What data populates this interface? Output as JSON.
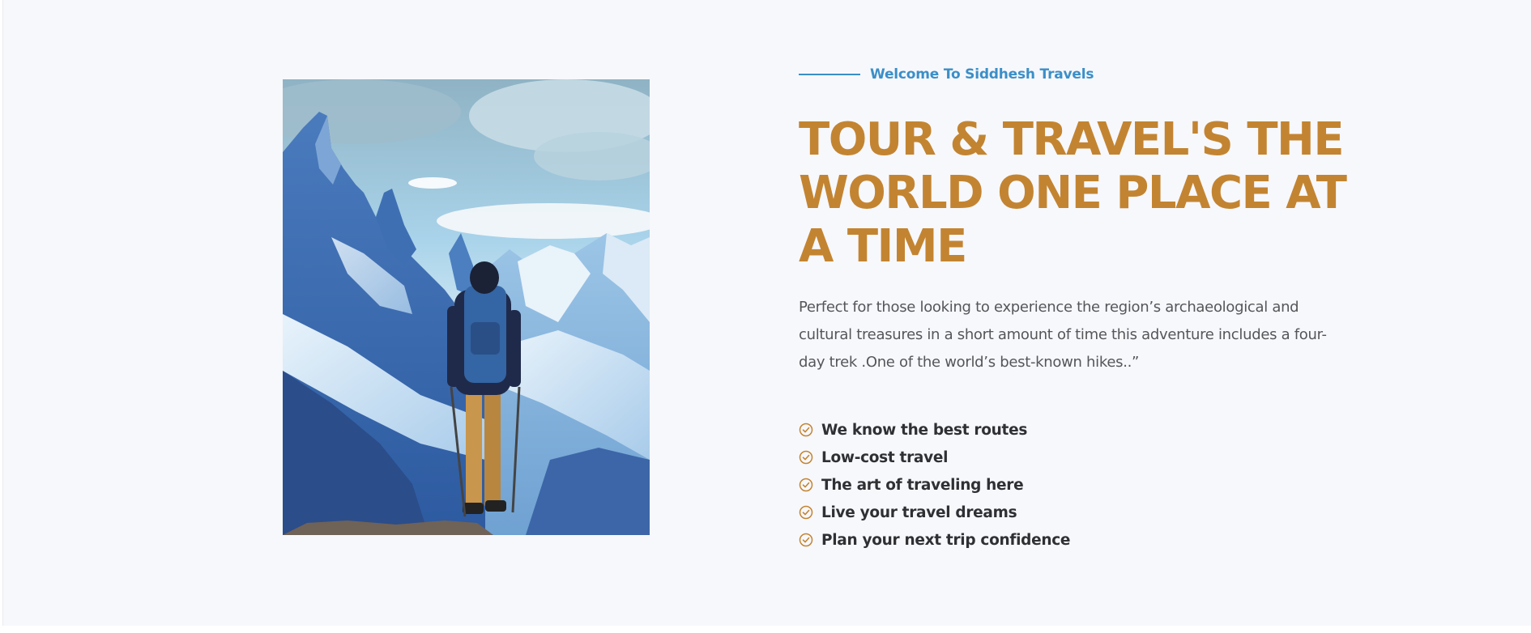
{
  "hero": {
    "image_alt": "Hiker with backpack overlooking snowy mountain peaks"
  },
  "about": {
    "tagline": "Welcome To Siddhesh Travels",
    "headline": "TOUR & TRAVEL'S THE WORLD ONE PLACE AT A TIME",
    "description": "Perfect for those looking to experience the region’s archaeological and cultural treasures in a short amount of time this adventure includes a four-day trek .One of the world’s best-known hikes..”",
    "features": [
      {
        "label": "We know the best routes",
        "icon": "check-circle-icon"
      },
      {
        "label": "Low-cost travel",
        "icon": "check-circle-icon"
      },
      {
        "label": "The art of traveling here",
        "icon": "check-circle-icon"
      },
      {
        "label": "Live your travel dreams",
        "icon": "check-circle-icon"
      },
      {
        "label": "Plan your next trip confidence",
        "icon": "check-circle-icon"
      }
    ]
  },
  "colors": {
    "accent_blue": "#3b8fc8",
    "headline_gold": "#c38431",
    "text_gray": "#55565a",
    "section_bg": "#f7f8fc"
  }
}
